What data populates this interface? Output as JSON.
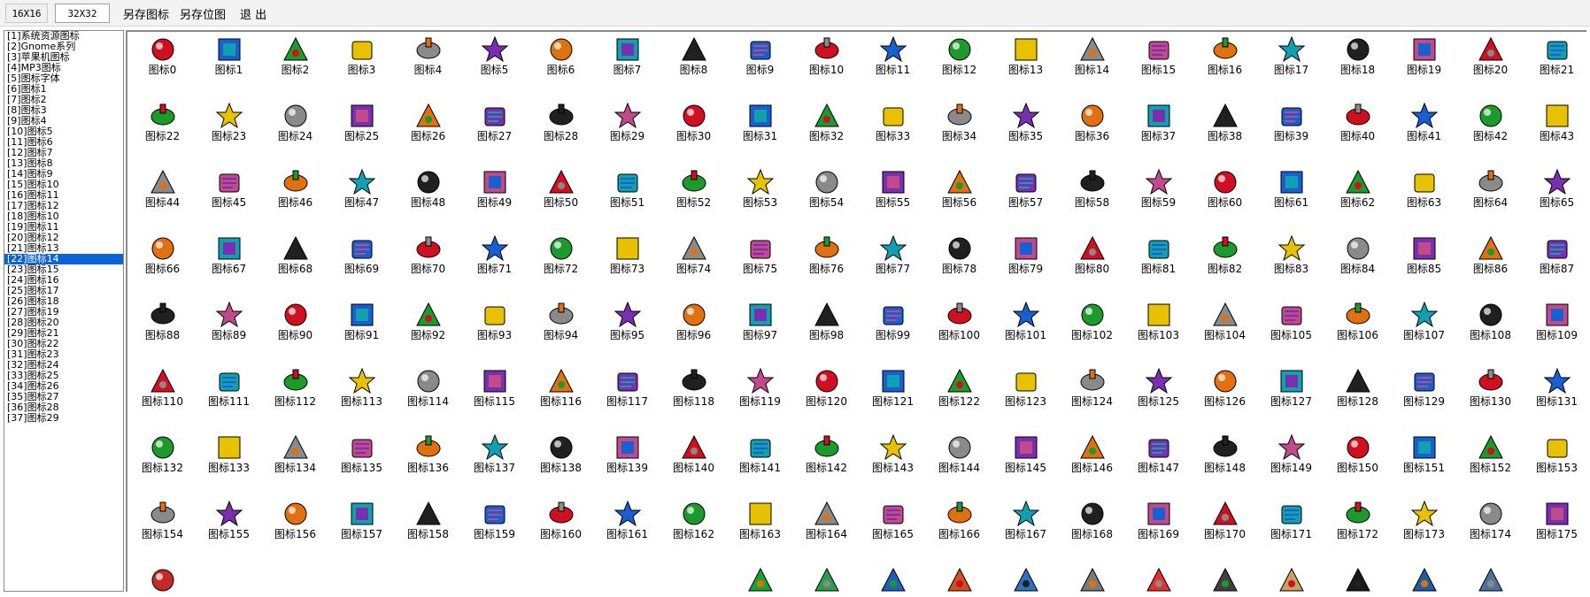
{
  "toolbar": {
    "size_16": "16X16",
    "size_32": "32X32",
    "save_icon": "另存图标",
    "save_bitmap": "另存位图",
    "exit": "退 出"
  },
  "tree": {
    "selected_index": 22,
    "items": [
      "[1]系统资源图标",
      "[2]Gnome系列",
      "[3]苹果机图标",
      "[4]MP3图标",
      "[5]图标字体",
      "[6]图标1",
      "[7]图标2",
      "[8]图标3",
      "[9]图标4",
      "[10]图标5",
      "[11]图标6",
      "[12]图标7",
      "[13]图标8",
      "[14]图标9",
      "[15]图标10",
      "[16]图标11",
      "[17]图标12",
      "[18]图标10",
      "[19]图标11",
      "[20]图标12",
      "[21]图标13",
      "[22]图标14",
      "[23]图标15",
      "[24]图标16",
      "[25]图标17",
      "[26]图标18",
      "[27]图标19",
      "[28]图标20",
      "[29]图标21",
      "[30]图标22",
      "[31]图标23",
      "[32]图标24",
      "[33]图标25",
      "[34]图标26",
      "[35]图标27",
      "[36]图标28",
      "[37]图标29"
    ]
  },
  "grid": {
    "columns": 22,
    "label_prefix": "图标",
    "count": 176,
    "palette": [
      "#d01020",
      "#1a5fd0",
      "#1c9a2c",
      "#e8c200",
      "#8a8a8a",
      "#7a2fb0",
      "#e07010",
      "#10a0b0",
      "#202020",
      "#c04a8a"
    ],
    "partial_row": [
      {
        "col": 0,
        "color": "#c62828"
      },
      {
        "col": 9,
        "color": "#1aa335"
      },
      {
        "col": 10,
        "color": "#2aa04a"
      },
      {
        "col": 11,
        "color": "#1e5fc0"
      },
      {
        "col": 12,
        "color": "#d05020"
      },
      {
        "col": 13,
        "color": "#3070c0"
      },
      {
        "col": 14,
        "color": "#7a7a7a"
      },
      {
        "col": 15,
        "color": "#e03030"
      },
      {
        "col": 16,
        "color": "#404040"
      },
      {
        "col": 17,
        "color": "#c8a060"
      },
      {
        "col": 18,
        "color": "#1a1a1a"
      },
      {
        "col": 19,
        "color": "#1a60a0"
      },
      {
        "col": 20,
        "color": "#5070a0"
      }
    ]
  }
}
